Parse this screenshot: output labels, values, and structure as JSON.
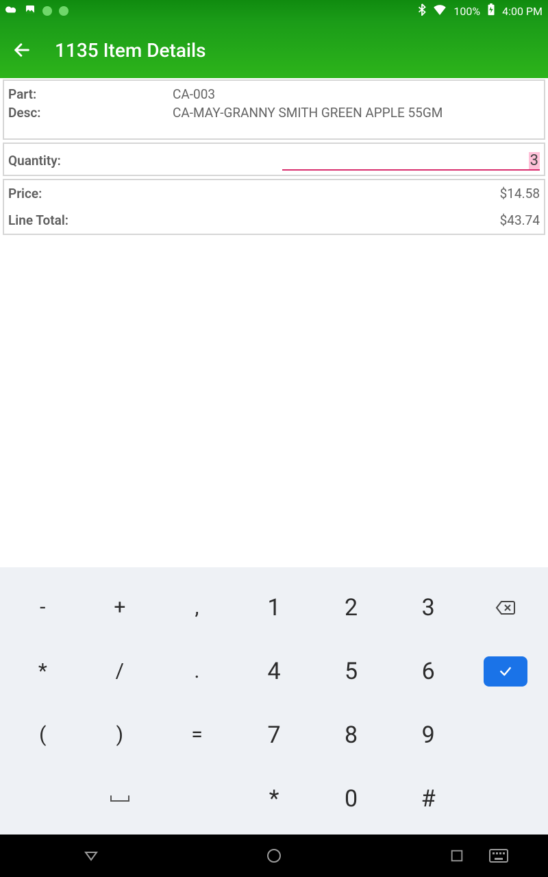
{
  "status": {
    "battery": "100%",
    "time": "4:00 PM"
  },
  "header": {
    "title": "1135 Item Details"
  },
  "item": {
    "part_label": "Part:",
    "part_value": "CA-003",
    "desc_label": "Desc:",
    "desc_value": "CA-MAY-GRANNY SMITH GREEN APPLE 55GM"
  },
  "quantity": {
    "label": "Quantity:",
    "value": "3"
  },
  "pricing": {
    "price_label": "Price:",
    "price_value": "$14.58",
    "total_label": "Line Total:",
    "total_value": "$43.74"
  },
  "keyboard": {
    "rows": [
      [
        "-",
        "+",
        ",",
        "1",
        "2",
        "3",
        "⌫"
      ],
      [
        "*",
        "/",
        ".",
        "4",
        "5",
        "6",
        "✓"
      ],
      [
        "(",
        ")",
        "=",
        "7",
        "8",
        "9",
        ""
      ],
      [
        "",
        "␣",
        "",
        "*",
        "0",
        "#",
        ""
      ]
    ]
  }
}
